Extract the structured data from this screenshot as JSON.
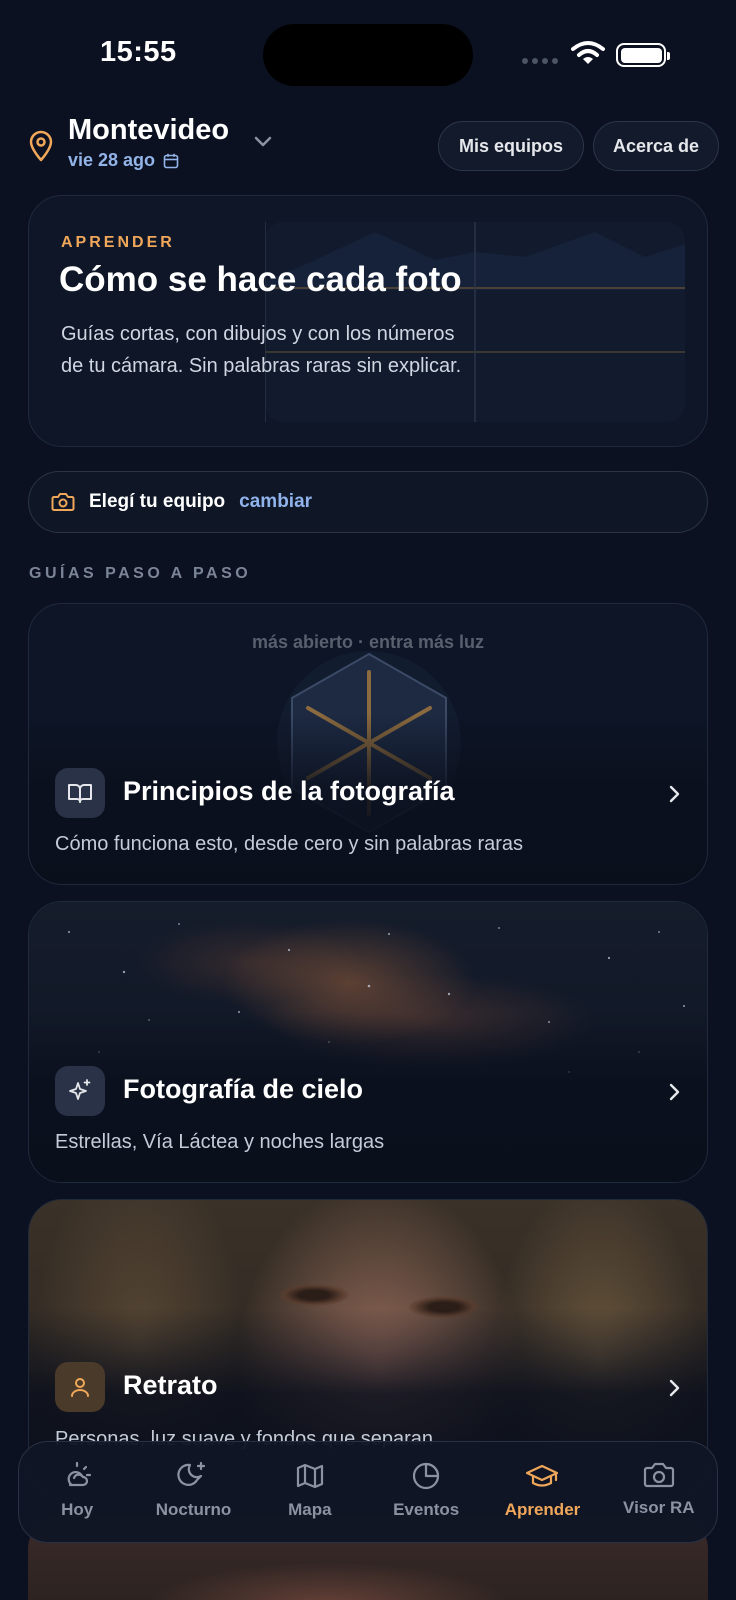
{
  "status_bar": {
    "time": "15:55"
  },
  "header": {
    "city": "Montevideo",
    "date": "vie 28 ago",
    "buttons": {
      "equipos": "Mis equipos",
      "acerca": "Acerca de"
    }
  },
  "hero": {
    "kicker": "APRENDER",
    "title": "Cómo se hace cada foto",
    "description": "Guías cortas, con dibujos y con los números de tu cámara. Sin palabras raras sin explicar."
  },
  "equipment": {
    "label": "Elegí tu equipo",
    "link": "cambiar"
  },
  "section_title": "GUÍAS PASO A PASO",
  "guides": [
    {
      "art_label": "más abierto · entra más luz",
      "title": "Principios de la fotografía",
      "description": "Cómo funciona esto, desde cero y sin palabras raras",
      "icon": "book-open-icon"
    },
    {
      "title": "Fotografía de cielo",
      "description": "Estrellas, Vía Láctea y noches largas",
      "icon": "sparkles-icon"
    },
    {
      "title": "Retrato",
      "description": "Personas, luz suave y fondos que separan",
      "icon": "user-icon"
    }
  ],
  "tabs": [
    {
      "label": "Hoy",
      "icon": "sun-cloud-icon",
      "active": false
    },
    {
      "label": "Nocturno",
      "icon": "moon-stars-icon",
      "active": false
    },
    {
      "label": "Mapa",
      "icon": "map-icon",
      "active": false
    },
    {
      "label": "Eventos",
      "icon": "pie-clock-icon",
      "active": false
    },
    {
      "label": "Aprender",
      "icon": "graduation-cap-icon",
      "active": true
    },
    {
      "label": "Visor RA",
      "icon": "camera-icon",
      "active": false
    }
  ],
  "colors": {
    "background": "#0b1120",
    "accent": "#f0a75a",
    "link": "#8fb3ea"
  }
}
